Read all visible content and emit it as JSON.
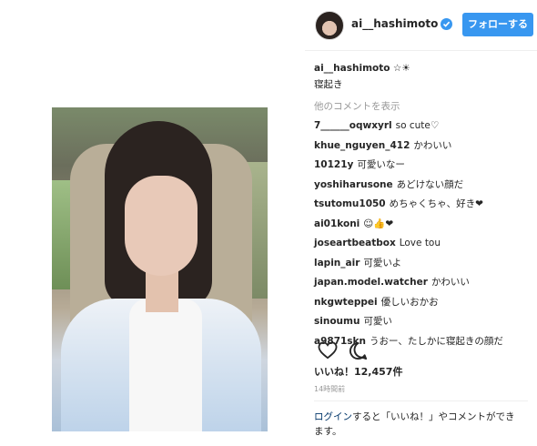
{
  "header": {
    "username": "ai__hashimoto",
    "follow_label": "フォローする"
  },
  "caption": {
    "user": "ai__hashimoto",
    "text": "☆☀",
    "line2": "寝起き"
  },
  "more_comments": "他のコメントを表示",
  "comments": [
    {
      "user": "7______oqwxyrl",
      "text": "so cute♡"
    },
    {
      "user": "khue_nguyen_412",
      "text": "かわいい"
    },
    {
      "user": "10121y",
      "text": "可愛いなー"
    },
    {
      "user": "yoshiharusone",
      "text": "あどけない顔だ"
    },
    {
      "user": "tsutomu1050",
      "text": "めちゃくちゃ、好き❤"
    },
    {
      "user": "ai01koni",
      "text": "☺👍❤"
    },
    {
      "user": "joseartbeatbox",
      "text": "Love tou"
    },
    {
      "user": "lapin_air",
      "text": "可愛いよ"
    },
    {
      "user": "japan.model.watcher",
      "text": "かわいい"
    },
    {
      "user": "nkgwteppei",
      "text": "優しいおかお"
    },
    {
      "user": "sinoumu",
      "text": "可愛い"
    },
    {
      "user": "a9871skn",
      "text": "うおー、たしかに寝起きの顔だ"
    }
  ],
  "likes_label": "いいね！12,457件",
  "timestamp": "14時間前",
  "login": {
    "link": "ログイン",
    "rest": "すると「いいね！」やコメントができます。"
  },
  "icons": {
    "like": "heart-icon",
    "comment": "comment-icon",
    "verified": "verified-badge-icon"
  },
  "colors": {
    "accent": "#3897f0",
    "muted": "#999999",
    "text": "#262626"
  }
}
